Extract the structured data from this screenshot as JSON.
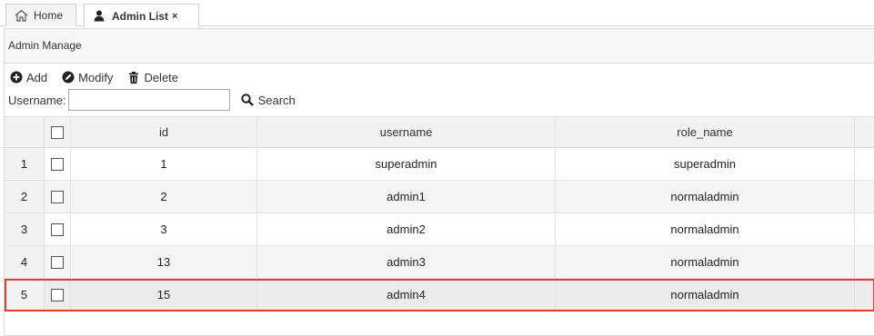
{
  "tabs": [
    {
      "label": "Home"
    },
    {
      "label": "Admin List",
      "close": "×"
    }
  ],
  "panel": {
    "title": "Admin Manage"
  },
  "toolbar": {
    "add": "Add",
    "modify": "Modify",
    "delete": "Delete"
  },
  "search": {
    "label": "Username:",
    "value": "",
    "button": "Search"
  },
  "grid": {
    "columns": [
      "id",
      "username",
      "role_name"
    ],
    "rows": [
      {
        "num": "1",
        "id": "1",
        "username": "superadmin",
        "role_name": "superadmin"
      },
      {
        "num": "2",
        "id": "2",
        "username": "admin1",
        "role_name": "normaladmin"
      },
      {
        "num": "3",
        "id": "3",
        "username": "admin2",
        "role_name": "normaladmin"
      },
      {
        "num": "4",
        "id": "13",
        "username": "admin3",
        "role_name": "normaladmin"
      },
      {
        "num": "5",
        "id": "15",
        "username": "admin4",
        "role_name": "normaladmin"
      }
    ],
    "highlighted_row": 5
  },
  "colors": {
    "highlight": "#e53935",
    "header_bg": "#f2f2f2"
  }
}
